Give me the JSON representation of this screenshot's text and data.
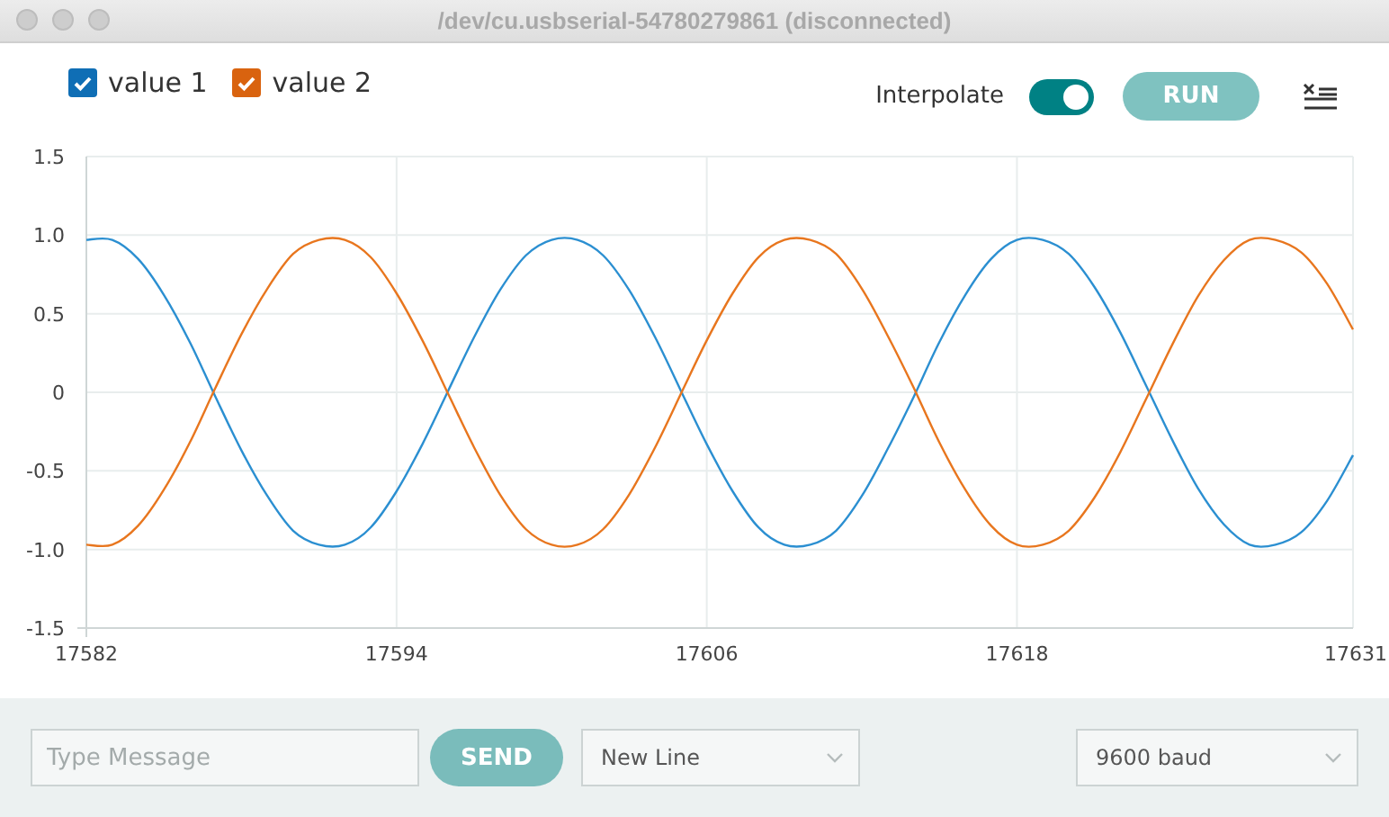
{
  "window": {
    "title": "/dev/cu.usbserial-54780279861 (disconnected)"
  },
  "legend": [
    {
      "checked": true,
      "color": "#0f6eb5"
    },
    {
      "checked": true,
      "color": "#d9630f"
    }
  ],
  "interpolate": {
    "label": "Interpolate",
    "on": true
  },
  "run_button": {
    "label": "RUN"
  },
  "chart": {
    "chart_data": {
      "type": "line",
      "grid": true,
      "x": [
        17582,
        17583,
        17584,
        17585,
        17586,
        17587,
        17588,
        17589,
        17590,
        17591,
        17592,
        17593,
        17594,
        17595,
        17596,
        17597,
        17598,
        17599,
        17600,
        17601,
        17602,
        17603,
        17604,
        17605,
        17606,
        17607,
        17608,
        17609,
        17610,
        17611,
        17612,
        17613,
        17614,
        17615,
        17616,
        17617,
        17618,
        17619,
        17620,
        17621,
        17622,
        17623,
        17624,
        17625,
        17626,
        17627,
        17628,
        17629,
        17630,
        17631
      ],
      "series": [
        {
          "name": "value 1",
          "color": "#2b8fd1",
          "values": [
            0.97,
            0.97,
            0.85,
            0.62,
            0.32,
            -0.03,
            -0.37,
            -0.66,
            -0.88,
            -0.97,
            -0.97,
            -0.86,
            -0.63,
            -0.33,
            0.01,
            0.35,
            0.65,
            0.87,
            0.97,
            0.97,
            0.87,
            0.65,
            0.35,
            0.01,
            -0.33,
            -0.63,
            -0.86,
            -0.97,
            -0.97,
            -0.88,
            -0.66,
            -0.36,
            -0.03,
            0.32,
            0.62,
            0.85,
            0.97,
            0.97,
            0.88,
            0.67,
            0.38,
            0.04,
            -0.3,
            -0.61,
            -0.84,
            -0.97,
            -0.97,
            -0.89,
            -0.69,
            -0.4
          ]
        },
        {
          "name": "value 2",
          "color": "#e8761e",
          "values": [
            -0.97,
            -0.97,
            -0.85,
            -0.62,
            -0.32,
            0.03,
            0.37,
            0.66,
            0.88,
            0.97,
            0.97,
            0.86,
            0.63,
            0.33,
            -0.01,
            -0.35,
            -0.65,
            -0.87,
            -0.97,
            -0.97,
            -0.87,
            -0.65,
            -0.35,
            -0.01,
            0.33,
            0.63,
            0.86,
            0.97,
            0.97,
            0.88,
            0.66,
            0.36,
            0.03,
            -0.32,
            -0.62,
            -0.85,
            -0.97,
            -0.97,
            -0.88,
            -0.67,
            -0.38,
            -0.04,
            0.3,
            0.61,
            0.84,
            0.97,
            0.97,
            0.89,
            0.69,
            0.4
          ]
        }
      ],
      "xlim": [
        17582,
        17631
      ],
      "ylim": [
        -1.5,
        1.5
      ],
      "xticks": [
        17582,
        17594,
        17606,
        17618,
        17631
      ],
      "yticks": [
        {
          "value": 1.5,
          "label": "1.5"
        },
        {
          "value": 1,
          "label": "1.0"
        },
        {
          "value": 0.5,
          "label": "0.5"
        },
        {
          "value": 0,
          "label": "0"
        },
        {
          "value": -0.5,
          "label": "-0.5"
        },
        {
          "value": -1,
          "label": "-1.0"
        },
        {
          "value": -1.5,
          "label": "-1.5"
        }
      ]
    }
  },
  "message": {
    "placeholder": "Type Message"
  },
  "send_button": {
    "label": "SEND"
  },
  "line_ending": {
    "value": "New Line"
  },
  "baud_rate": {
    "value": "9600 baud"
  }
}
